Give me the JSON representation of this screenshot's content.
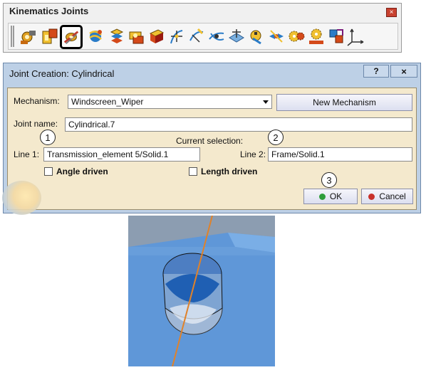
{
  "toolbar": {
    "title": "Kinematics Joints",
    "close_glyph": "×",
    "icons": [
      "revolute-joint-icon",
      "prismatic-joint-icon",
      "cylindrical-joint-icon",
      "screw-joint-icon",
      "rigid-joint-icon",
      "spherical-joint-icon",
      "planar-joint-icon",
      "point-curve-joint-icon",
      "slide-curve-joint-icon",
      "roll-curve-joint-icon",
      "point-surface-joint-icon",
      "universal-joint-icon",
      "cv-joint-icon",
      "gear-joint-icon",
      "rack-joint-icon",
      "cable-joint-icon",
      "axis-system-joint-icon"
    ]
  },
  "dialog": {
    "title": "Joint Creation: Cylindrical",
    "help_glyph": "?",
    "close_glyph": "×",
    "mechanism_label": "Mechanism:",
    "mechanism_value": "Windscreen_Wiper",
    "new_mechanism_label": "New Mechanism",
    "joint_name_label": "Joint name:",
    "joint_name_value": "Cylindrical.7",
    "current_selection_label": "Current selection:",
    "line1_label": "Line 1:",
    "line1_value": "Transmission_element 5/Solid.1",
    "line2_label": "Line 2:",
    "line2_value": "Frame/Solid.1",
    "angle_driven_label": "Angle driven",
    "length_driven_label": "Length driven",
    "ok_label": "OK",
    "cancel_label": "Cancel",
    "colors": {
      "ok_dot": "#2f9e3a",
      "cancel_dot": "#c8312a",
      "accent_blue": "#6d88aa"
    }
  },
  "callouts": {
    "c1": "1",
    "c2": "2",
    "c3": "3"
  },
  "viewport": {
    "name": "3d-geometry-view"
  }
}
